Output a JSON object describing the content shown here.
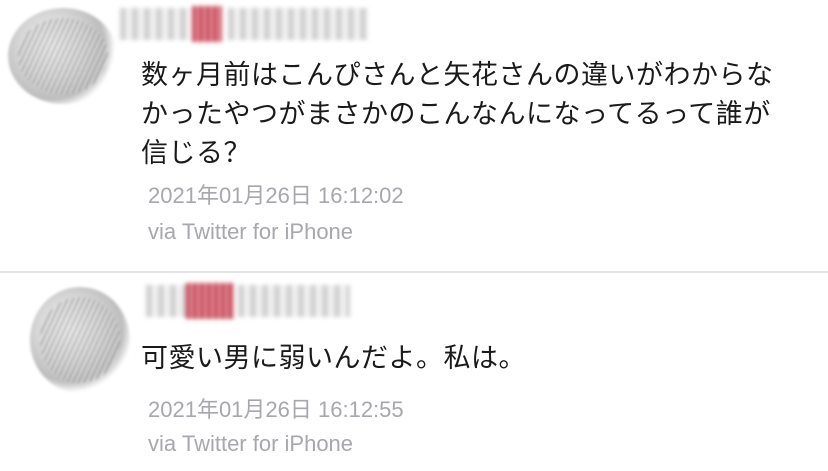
{
  "tweets": [
    {
      "text": "数ヶ月前はこんぴさんと矢花さんの違いがわからな\nかったやつがまさかのこんなんになってるって誰が\n信じる？",
      "timestamp": "2021年01月26日 16:12:02",
      "source": "via Twitter for iPhone"
    },
    {
      "text": "可愛い男に弱いんだよ。私は。",
      "timestamp": "2021年01月26日 16:12:55",
      "source": "via Twitter for iPhone"
    }
  ]
}
